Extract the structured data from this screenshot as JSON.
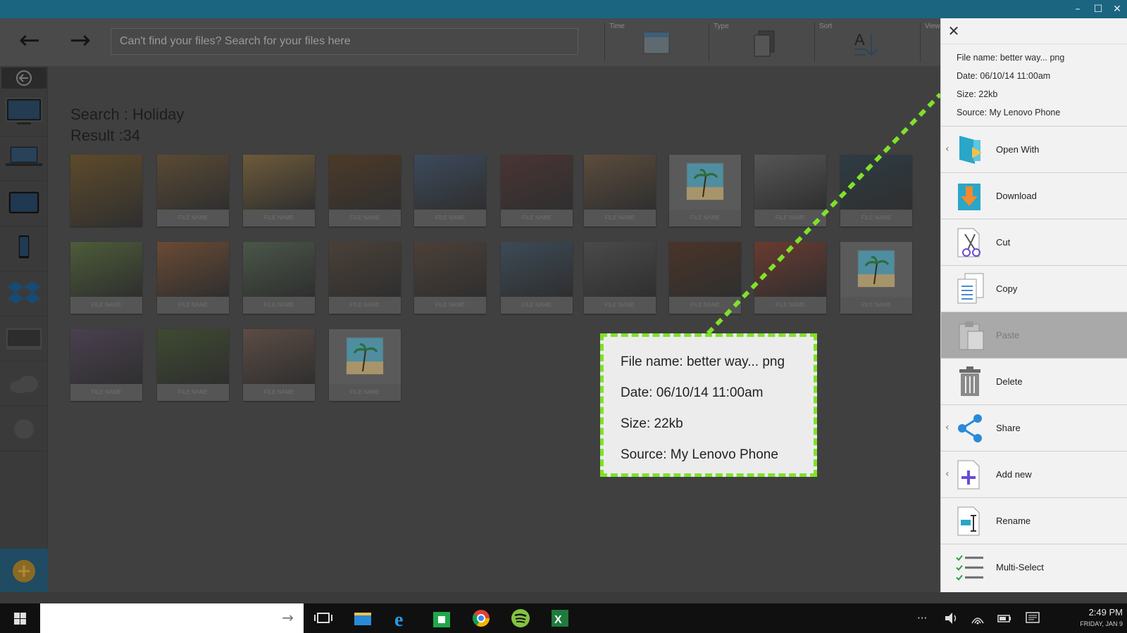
{
  "window": {
    "minimize": "–",
    "maximize": "☐",
    "close": "✕"
  },
  "toolbar": {
    "back_glyph": "←",
    "forward_glyph": "→",
    "search_placeholder": "Can't find your files? Search for your files here",
    "time_label": "Time",
    "type_label": "Type",
    "sort_label": "Sort",
    "view_label": "View"
  },
  "sidebar": {
    "items": [
      "monitor-icon",
      "laptop-icon",
      "tablet-icon",
      "phone-icon",
      "dropbox-icon",
      "drive-icon",
      "cloud-icon",
      "google-drive-icon"
    ]
  },
  "content": {
    "search_line": "Search : Holiday",
    "result_line": "Result :34",
    "thumbs": [
      {
        "caption": "",
        "color": "#5e4a2a"
      },
      {
        "caption": "FILE NAME",
        "color": "#5a4a34"
      },
      {
        "caption": "FILE NAME",
        "color": "#6e5a3a"
      },
      {
        "caption": "FILE NAME",
        "color": "#4d3a28"
      },
      {
        "caption": "FILE NAME",
        "color": "#3c4a5c"
      },
      {
        "caption": "FILE NAME",
        "color": "#4a3434"
      },
      {
        "caption": "FILE NAME",
        "color": "#5c4c3c"
      },
      {
        "caption": "FILE NAME",
        "color": "#3f7f8f"
      },
      {
        "caption": "FILE NAME",
        "color": "#565656"
      },
      {
        "caption": "FILE NAME",
        "color": "#2e3c44"
      },
      {
        "caption": "FILE NAME",
        "color": "#4c5c38"
      },
      {
        "caption": "FILE NAME",
        "color": "#6a4a34"
      },
      {
        "caption": "FILE NAME",
        "color": "#4a5648"
      },
      {
        "caption": "FILE NAME",
        "color": "#4a4038"
      },
      {
        "caption": "FILE NAME",
        "color": "#4c4038"
      },
      {
        "caption": "FILE NAME",
        "color": "#3c4a56"
      },
      {
        "caption": "FILE NAME",
        "color": "#4a4a4a"
      },
      {
        "caption": "FILE NAME",
        "color": "#4a3428"
      },
      {
        "caption": "FILE NAME",
        "color": "#6a3a30"
      },
      {
        "caption": "FILE NAME",
        "color": "#3f7f8f"
      },
      {
        "caption": "FILE NAME",
        "color": "#4a4050"
      },
      {
        "caption": "FILE NAME",
        "color": "#3e4a30"
      },
      {
        "caption": "FILE NAME",
        "color": "#5c4c44"
      },
      {
        "caption": "FILE NAME",
        "color": "#3f7f8f"
      }
    ]
  },
  "tooltip": {
    "file_name": "File name: better way... png",
    "date": "Date: 06/10/14 11:00am",
    "size": "Size: 22kb",
    "source": "Source: My Lenovo Phone"
  },
  "panel": {
    "close_glyph": "✕",
    "file_name": "File name: better way... png",
    "date": "Date: 06/10/14 11:00am",
    "size": "Size: 22kb",
    "source": "Source: My Lenovo Phone",
    "actions": [
      {
        "label": "Open With",
        "icon": "open-with-icon",
        "chevron": "‹"
      },
      {
        "label": "Download",
        "icon": "download-icon",
        "chevron": ""
      },
      {
        "label": "Cut",
        "icon": "scissors-icon",
        "chevron": ""
      },
      {
        "label": "Copy",
        "icon": "copy-icon",
        "chevron": ""
      },
      {
        "label": "Paste",
        "icon": "paste-icon",
        "chevron": ""
      },
      {
        "label": "Delete",
        "icon": "trash-icon",
        "chevron": ""
      },
      {
        "label": "Share",
        "icon": "share-icon",
        "chevron": "‹"
      },
      {
        "label": "Add new",
        "icon": "add-new-icon",
        "chevron": "‹"
      },
      {
        "label": "Rename",
        "icon": "rename-icon",
        "chevron": ""
      },
      {
        "label": "Multi-Select",
        "icon": "multi-select-icon",
        "chevron": ""
      }
    ]
  },
  "taskbar": {
    "search_arrow": "→",
    "tray_more": "···",
    "time": "2:49 PM",
    "date": "FRIDAY, JAN 9"
  },
  "colors": {
    "accent": "#7fe22a",
    "titlebar": "#1c6580"
  }
}
